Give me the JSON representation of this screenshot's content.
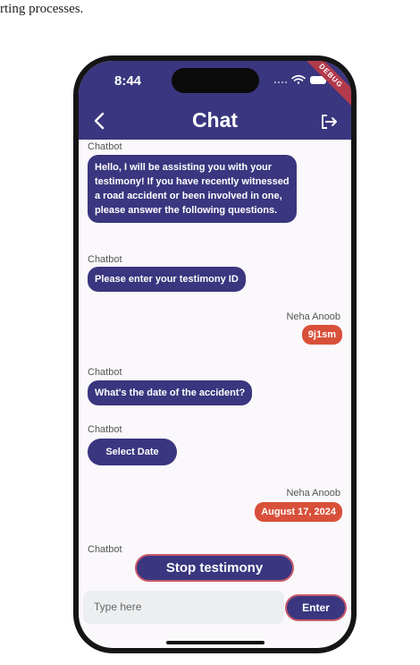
{
  "caption": "rting processes.",
  "status_bar": {
    "time": "8:44",
    "debug_label": "DEBUG"
  },
  "header": {
    "title": "Chat"
  },
  "messages": [
    {
      "sender": "Chatbot",
      "text": "Hello, I  will be assisting you with your testimony! If you have recently witnessed  a road accident or been involved in one,  please answer the following questions."
    },
    {
      "sender": "Chatbot",
      "text": "Please enter your testimony ID"
    },
    {
      "sender": "Neha Anoob",
      "text": "9j1sm"
    },
    {
      "sender": "Chatbot",
      "text": "What's the date of the accident?"
    },
    {
      "sender": "Chatbot",
      "button": "Select Date"
    },
    {
      "sender": "Neha Anoob",
      "text": "August 17, 2024"
    },
    {
      "sender": "Chatbot"
    }
  ],
  "actions": {
    "stop_label": "Stop testimony"
  },
  "composer": {
    "placeholder": "Type here",
    "enter_label": "Enter"
  },
  "colors": {
    "primary": "#3a367f",
    "user_bubble": "#d9503a",
    "accent_border": "#c85a6a"
  }
}
